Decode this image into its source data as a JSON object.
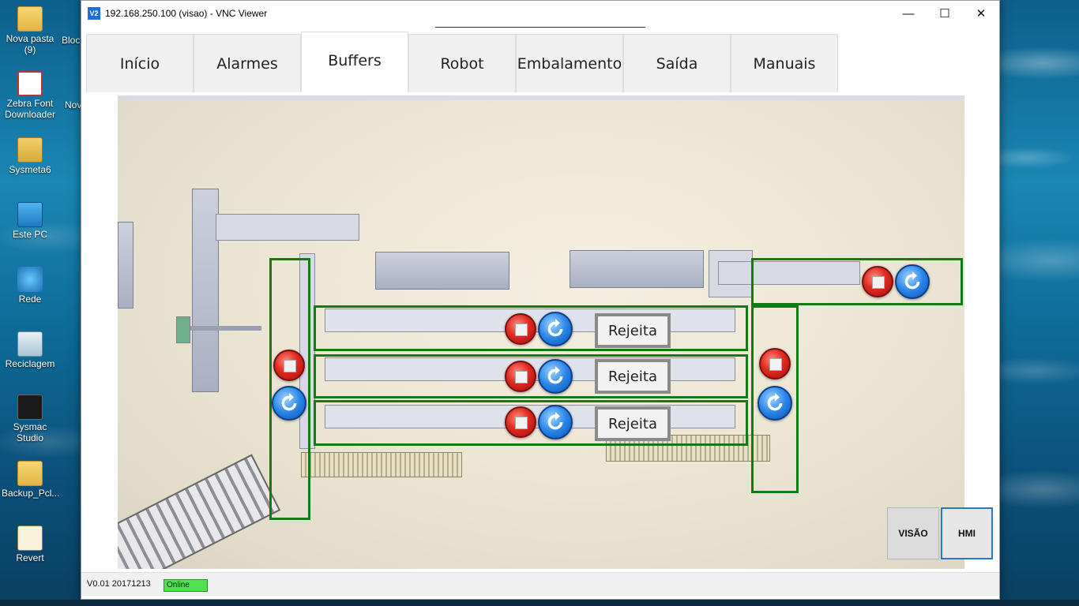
{
  "desktop": {
    "icons": [
      {
        "label": "Nova pasta\n(9)",
        "icon": "folder-icon"
      },
      {
        "label": "Zebra Font\nDownloader",
        "icon": "zebra-font-icon"
      },
      {
        "label": "Sysmeta6",
        "icon": "user-folder-icon"
      },
      {
        "label": "Este PC",
        "icon": "computer-icon"
      },
      {
        "label": "Rede",
        "icon": "network-icon"
      },
      {
        "label": "Reciclagem",
        "icon": "recycle-bin-icon"
      },
      {
        "label": "Sysmac\nStudio",
        "icon": "sysmac-studio-icon"
      },
      {
        "label": "Backup_Pcl...",
        "icon": "folder-icon"
      },
      {
        "label": "Revert",
        "icon": "document-icon"
      }
    ],
    "partial_labels": [
      "Bloc",
      "Nov"
    ]
  },
  "window": {
    "title": "192.168.250.100 (visao) - VNC Viewer",
    "logo": "V2",
    "controls": {
      "minimize": "—",
      "maximize": "☐",
      "close": "✕"
    }
  },
  "tabs": [
    {
      "label": "Início",
      "active": false
    },
    {
      "label": "Alarmes",
      "active": false
    },
    {
      "label": "Buffers",
      "active": true
    },
    {
      "label": "Robot",
      "active": false
    },
    {
      "label": "Embalamento",
      "active": false
    },
    {
      "label": "Saída",
      "active": false
    },
    {
      "label": "Manuais",
      "active": false
    }
  ],
  "buffers": {
    "rows": [
      {
        "reject_label": "Rejeita"
      },
      {
        "reject_label": "Rejeita"
      },
      {
        "reject_label": "Rejeita"
      }
    ]
  },
  "side_buttons": {
    "visao": "VISÃO",
    "hmi": "HMI"
  },
  "status": {
    "version": "V0.01 20171213",
    "connection": "Online"
  },
  "colors": {
    "zone_outline": "#157a15",
    "online": "#4fe34f",
    "active_button_border": "#2c78c6"
  }
}
